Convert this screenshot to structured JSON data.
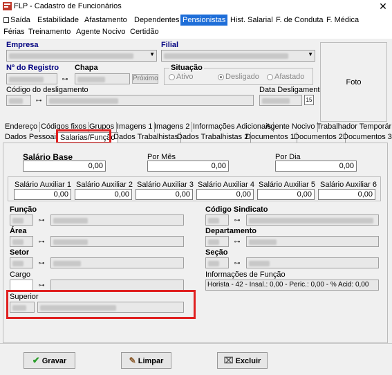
{
  "window": {
    "title": "FLP - Cadastro de Funcionários",
    "close_glyph": "✕"
  },
  "menu": {
    "row1": [
      "Saída",
      "Estabilidade",
      "Afastamento",
      "Dependentes",
      "Pensionistas",
      "Hist. Salarial",
      "F. de Conduta",
      "F. Médica"
    ],
    "row2": [
      "Férias",
      "Treinamento",
      "Agente Nocivo",
      "Certidão"
    ],
    "active": "Pensionistas"
  },
  "header": {
    "empresa_label": "Empresa",
    "filial_label": "Filial",
    "registro_label": "Nº do Registro",
    "chapa_label": "Chapa",
    "proximo_button": "Próximo",
    "situacao_label": "Situação",
    "situacao_options": [
      "Ativo",
      "Desligado",
      "Afastado"
    ],
    "situacao_selected": "Desligado",
    "codigo_desligamento_label": "Código do desligamento",
    "data_desligamento_label": "Data Desligamento",
    "calendar_label": "15",
    "foto_label": "Foto"
  },
  "tabs": {
    "row1": [
      "Endereço",
      "Códigos fixos",
      "Grupos",
      "Imagens 1",
      "Imagens 2",
      "Informações Adicionais",
      "Agente Nocivo",
      "Trabalhador Temporário"
    ],
    "row2": [
      "Dados Pessoais",
      "Salarias/Função",
      "Dados Trabalhistas",
      "Dados Trabalhistas 2",
      "Documentos 1",
      "Documentos 2",
      "Documentos 3"
    ],
    "selected": "Salarias/Função"
  },
  "salario": {
    "base_label": "Salário Base",
    "base_value": "0,00",
    "por_mes_label": "Por Mês",
    "por_mes_value": "0,00",
    "por_dia_label": "Por Dia",
    "por_dia_value": "0,00",
    "auxiliares": [
      {
        "label": "Salário Auxiliar 1",
        "value": "0,00"
      },
      {
        "label": "Salário Auxiliar 2",
        "value": "0,00"
      },
      {
        "label": "Salário Auxiliar 3",
        "value": "0,00"
      },
      {
        "label": "Salário Auxiliar 4",
        "value": "0,00"
      },
      {
        "label": "Salário Auxiliar 5",
        "value": "0,00"
      },
      {
        "label": "Salário Auxiliar 6",
        "value": "0,00"
      }
    ]
  },
  "fields": {
    "funcao_label": "Função",
    "area_label": "Área",
    "setor_label": "Setor",
    "cargo_label": "Cargo",
    "superior_label": "Superior",
    "codigo_sindicato_label": "Código Sindicato",
    "departamento_label": "Departamento",
    "secao_label": "Seção",
    "info_funcao_label": "Informações de Função",
    "info_funcao_value": "Horista - 42 - Insal.: 0,00 - Peric.: 0,00 - % Acid: 0,00"
  },
  "footer": {
    "gravar": "Gravar",
    "limpar": "Limpar",
    "excluir": "Excluir"
  },
  "colors": {
    "accent": "#1e6ed8",
    "highlight": "#e02020",
    "label_blue": "#000080"
  }
}
